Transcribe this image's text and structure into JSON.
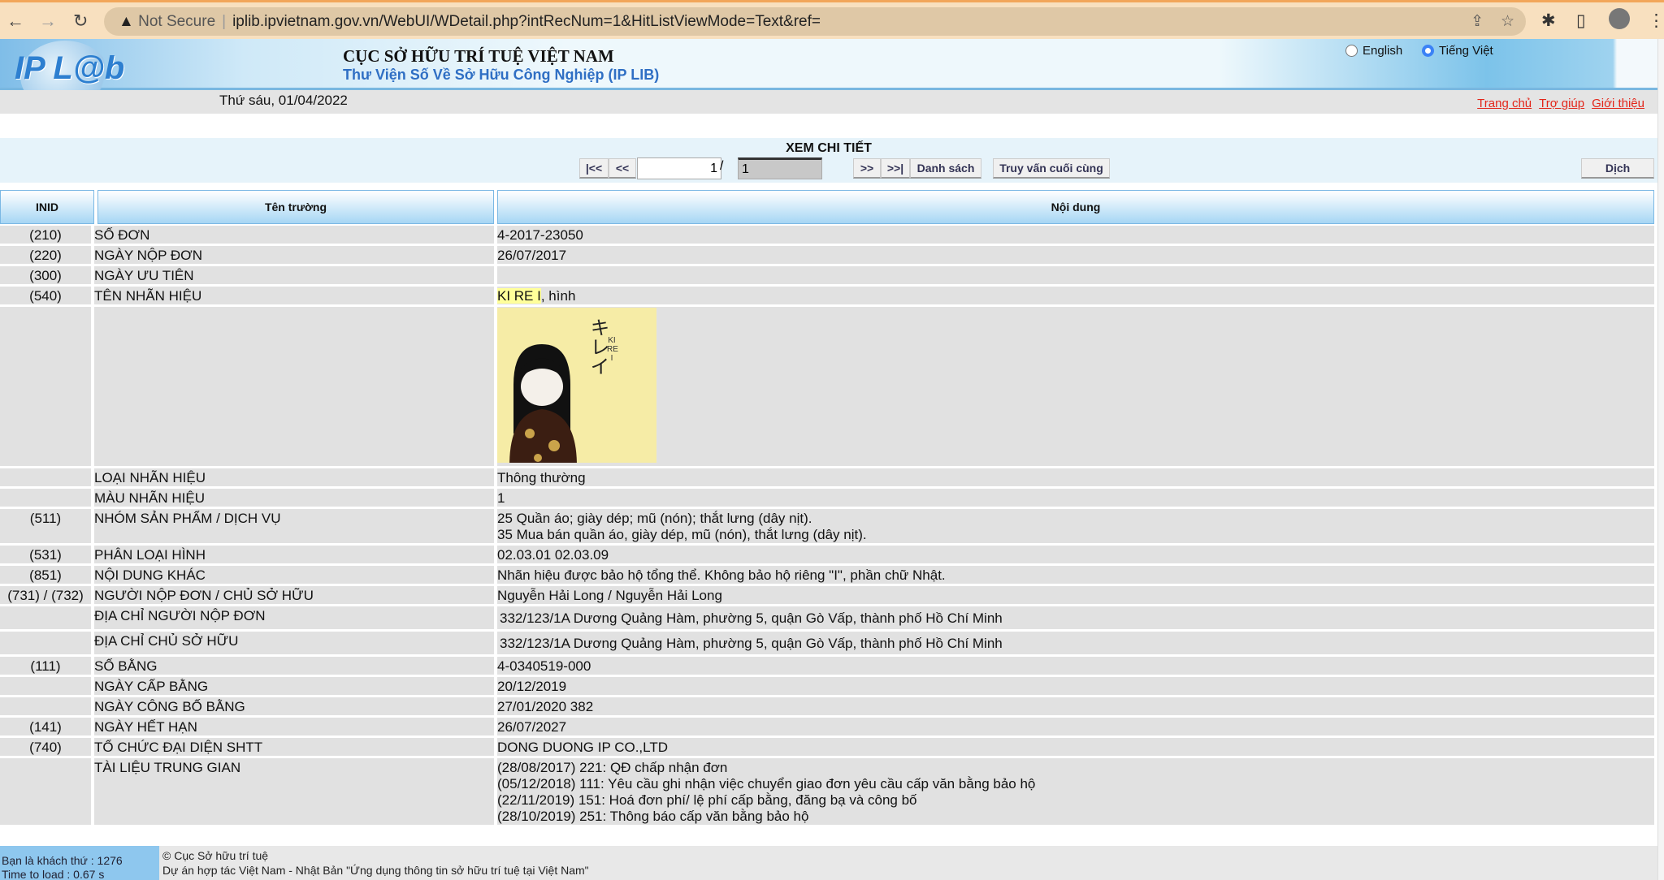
{
  "browser": {
    "security": "Not Secure",
    "url": "iplib.ipvietnam.gov.vn/WebUI/WDetail.php?intRecNum=1&HitListViewMode=Text&ref="
  },
  "header": {
    "logo": "IP L@b",
    "title": "CỤC SỞ HỮU TRÍ TUỆ VIỆT NAM",
    "subtitle": "Thư Viện Số Về Sở Hữu Công Nghiệp (IP LIB)",
    "languages": [
      {
        "label": "English",
        "selected": false
      },
      {
        "label": "Tiếng Việt",
        "selected": true
      }
    ],
    "date": "Thứ sáu, 01/04/2022",
    "links": [
      "Trang chủ",
      "Trợ giúp",
      "Giới thiệu"
    ]
  },
  "toolbar": {
    "title": "XEM CHI TIẾT",
    "first": "|<<",
    "prev": "<<",
    "page": "1",
    "separator": "/",
    "total": "1",
    "next": ">>",
    "last": ">>|",
    "list": "Danh sách",
    "last_query": "Truy vấn cuối cùng",
    "translate": "Dịch"
  },
  "columns": [
    "INID",
    "Tên trường",
    "Nội dung"
  ],
  "rows": [
    {
      "inid": "(210)",
      "field": "SỐ ĐƠN",
      "value": [
        "4-2017-23050"
      ]
    },
    {
      "inid": "(220)",
      "field": "NGÀY NỘP ĐƠN",
      "value": [
        "26/07/2017"
      ]
    },
    {
      "inid": "(300)",
      "field": "NGÀY ƯU TIÊN",
      "value": [
        ""
      ]
    },
    {
      "inid": "(540)",
      "field": "TÊN NHÃN HIỆU",
      "value": [
        "KI RE I",
        ", hình"
      ]
    },
    {
      "inid": "",
      "field": "",
      "value": [
        ""
      ],
      "mark_image": {
        "kana": "キレイ",
        "latin": "KI RE I"
      }
    },
    {
      "inid": "",
      "field": "LOẠI NHÃN HIỆU",
      "value": [
        "Thông thường"
      ]
    },
    {
      "inid": "",
      "field": "MÀU NHÃN HIỆU",
      "value": [
        "1"
      ]
    },
    {
      "inid": "(511)",
      "field": "NHÓM SẢN PHẨM / DỊCH VỤ",
      "value": [
        "25 Quần áo; giày dép; mũ (nón); thắt lưng (dây nịt).",
        "35 Mua bán quần áo, giày dép, mũ (nón), thắt lưng (dây nịt)."
      ]
    },
    {
      "inid": "(531)",
      "field": "PHÂN LOẠI HÌNH",
      "value": [
        "02.03.01 02.03.09"
      ]
    },
    {
      "inid": "(851)",
      "field": "NỘI DUNG KHÁC",
      "value": [
        "Nhãn hiệu được bảo hộ tổng thể. Không bảo hộ riêng \"I\", phần chữ Nhật."
      ]
    },
    {
      "inid": "(731) / (732)",
      "field": "NGƯỜI NỘP ĐƠN / CHỦ SỞ HỮU",
      "value": [
        "Nguyễn Hải Long / Nguyễn Hải Long"
      ]
    },
    {
      "inid": "",
      "field": "ĐỊA CHỈ NGƯỜI NỘP ĐƠN",
      "value": [
        "332/123/1A Dương Quảng Hàm, phường 5, quận Gò Vấp, thành phố Hồ Chí Minh"
      ]
    },
    {
      "inid": "",
      "field": "ĐỊA CHỈ CHỦ SỞ HỮU",
      "value": [
        "332/123/1A Dương Quảng Hàm, phường 5, quận Gò Vấp, thành phố Hồ Chí Minh"
      ]
    },
    {
      "inid": "(111)",
      "field": "SỐ BẰNG",
      "value": [
        "4-0340519-000"
      ]
    },
    {
      "inid": "",
      "field": "NGÀY CẤP BẰNG",
      "value": [
        "20/12/2019"
      ]
    },
    {
      "inid": "",
      "field": "NGÀY CÔNG BỐ BẰNG",
      "value": [
        "27/01/2020   382"
      ]
    },
    {
      "inid": "(141)",
      "field": "NGÀY HẾT HẠN",
      "value": [
        "26/07/2027"
      ]
    },
    {
      "inid": "(740)",
      "field": "TỔ CHỨC ĐẠI DIỆN SHTT",
      "value": [
        "DONG DUONG IP CO.,LTD"
      ]
    },
    {
      "inid": "",
      "field": "TÀI LIỆU TRUNG GIAN",
      "value": [
        "(28/08/2017) 221: QĐ chấp nhận đơn",
        "(05/12/2018) 111: Yêu cầu ghi nhận việc chuyển giao đơn yêu cầu cấp văn bằng bảo hộ",
        "(22/11/2019) 151: Hoá đơn phí/ lệ phí cấp bằng, đăng bạ và công bố",
        "(28/10/2019) 251: Thông báo cấp văn bằng bảo hộ"
      ]
    }
  ],
  "footer": {
    "visitors": "Bạn là khách thứ : 1276",
    "load_time": "Time to load : 0.67 s",
    "copyright": "© Cục Sở hữu trí tuệ",
    "project": "Dự án hợp tác Việt Nam - Nhật Bản \"Ứng dụng thông tin sở hữu trí tuệ tại Việt Nam\""
  }
}
